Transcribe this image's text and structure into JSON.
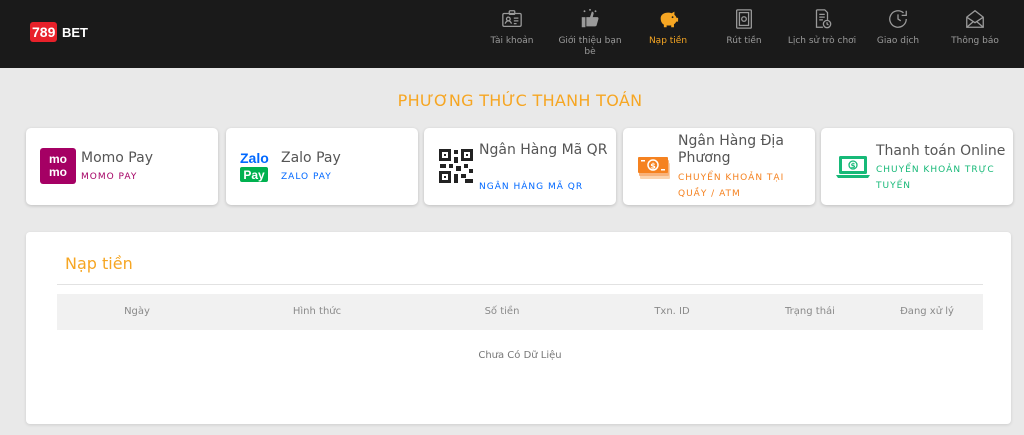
{
  "brand": {
    "logo_num": "789",
    "logo_text": "BET"
  },
  "nav": {
    "items": [
      {
        "label": "Tài khoản",
        "icon": "id-card-icon"
      },
      {
        "label": "Giới thiệu bạn bè",
        "icon": "referral-icon"
      },
      {
        "label": "Nạp tiền",
        "icon": "piggy-bank-icon",
        "active": true
      },
      {
        "label": "Rút tiền",
        "icon": "safe-icon"
      },
      {
        "label": "Lịch sử trò chơi",
        "icon": "history-icon"
      },
      {
        "label": "Giao dịch",
        "icon": "clock-icon"
      },
      {
        "label": "Thông báo",
        "icon": "mail-icon"
      }
    ]
  },
  "section": {
    "title": "PHƯƠNG THỨC THANH TOÁN"
  },
  "methods": [
    {
      "name": "Momo Pay",
      "sub": "MOMO PAY",
      "icon": "momo-logo-icon"
    },
    {
      "name": "Zalo Pay",
      "sub": "ZALO PAY",
      "icon": "zalopay-logo-icon"
    },
    {
      "name": "Ngân Hàng Mã QR",
      "sub": "NGÂN HÀNG MÃ QR",
      "icon": "qr-code-icon"
    },
    {
      "name": "Ngân Hàng Địa Phương",
      "sub": "CHUYỂN KHOẢN TẠI QUẦY / ATM",
      "icon": "cash-icon"
    },
    {
      "name": "Thanh toán Online",
      "sub": "CHUYỂN KHOẢN TRỰC TUYẾN",
      "icon": "laptop-payment-icon"
    }
  ],
  "deposit": {
    "title": "Nạp tiền",
    "columns": [
      "Ngày",
      "Hình thức",
      "Số tiền",
      "Txn. ID",
      "Trạng thái",
      "Đang xử lý"
    ],
    "empty_text": "Chưa Có Dữ Liệu"
  },
  "colors": {
    "accent": "#f6a623",
    "topbar": "#1a1a1a",
    "momo": "#a50064",
    "zalo_blue": "#0068ff",
    "zalo_green": "#00b14f",
    "local_bank": "#f58220",
    "online": "#17b978"
  }
}
